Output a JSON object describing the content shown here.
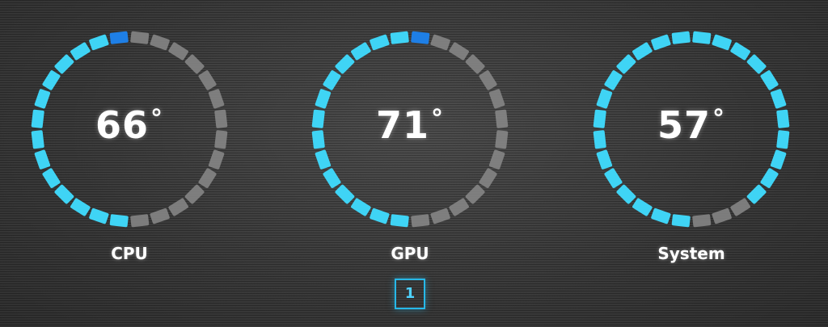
{
  "gauges": [
    {
      "id": "cpu",
      "label": "CPU",
      "value": "66",
      "degree_symbol": "°",
      "fill_fraction": 0.5
    },
    {
      "id": "gpu",
      "label": "GPU",
      "value": "71",
      "degree_symbol": "°",
      "fill_fraction": 0.54
    },
    {
      "id": "system",
      "label": "System",
      "value": "57",
      "degree_symbol": "°",
      "fill_fraction": 0.89
    }
  ],
  "page_indicator": {
    "value": "1"
  },
  "colors": {
    "active_segment": "#3fd4f5",
    "active_segment_accent": "#1e7fe6",
    "inactive_segment": "#8a8a8a",
    "label_text": "#ffffff",
    "indicator": "#27b8e8"
  }
}
